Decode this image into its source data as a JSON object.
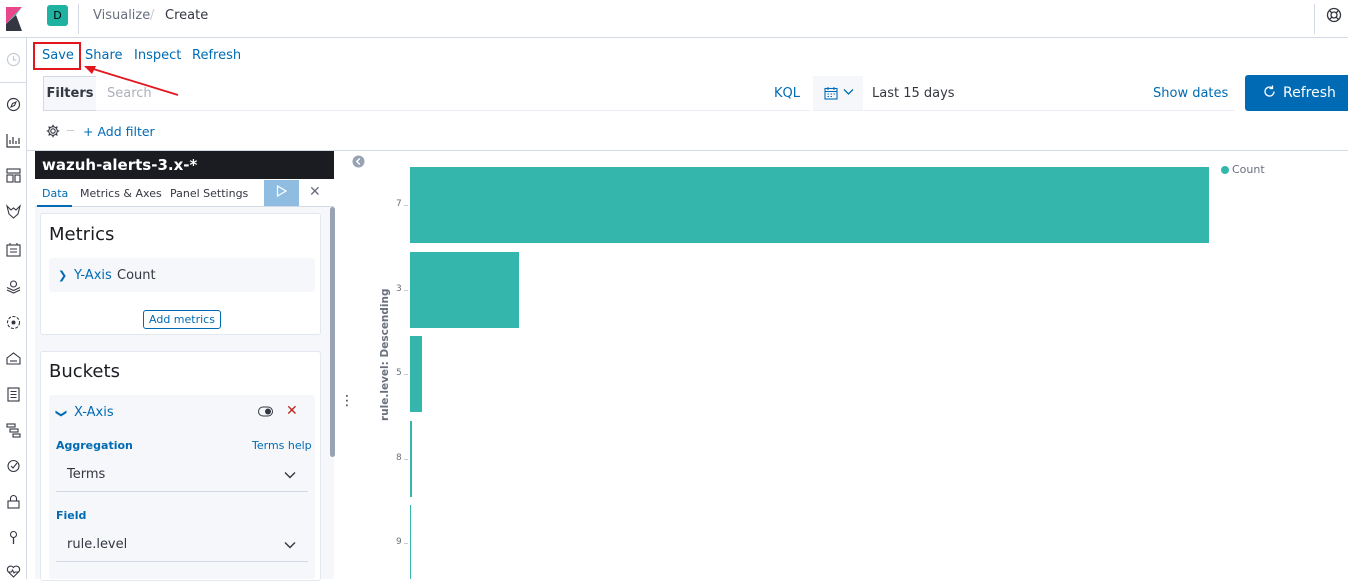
{
  "app": {
    "space_initial": "D",
    "breadcrumbs": [
      "Visualize",
      "Create"
    ]
  },
  "menu": {
    "save": "Save",
    "share": "Share",
    "inspect": "Inspect",
    "refresh": "Refresh"
  },
  "query_bar": {
    "filters_label": "Filters",
    "search_placeholder": "Search",
    "kql": "KQL",
    "date_range": "Last 15 days",
    "show_dates": "Show dates",
    "refresh_button": "Refresh",
    "add_filter": "+ Add filter"
  },
  "editor": {
    "index_pattern": "wazuh-alerts-3.x-*",
    "tabs": [
      "Data",
      "Metrics & Axes",
      "Panel Settings"
    ],
    "active_tab": "Data",
    "metrics": {
      "title": "Metrics",
      "y_axis_label": "Y-Axis",
      "y_axis_value": "Count",
      "add_button": "Add metrics"
    },
    "buckets": {
      "title": "Buckets",
      "x_axis_label": "X-Axis",
      "aggregation_label": "Aggregation",
      "aggregation_help": "Terms help",
      "aggregation_value": "Terms",
      "field_label": "Field",
      "field_value": "rule.level"
    }
  },
  "accent_color": "#006bb4",
  "bar_color": "#34b6ad",
  "chart_data": {
    "type": "bar",
    "orientation": "horizontal",
    "ylabel": "rule.level: Descending",
    "categories": [
      "7",
      "3",
      "5",
      "8",
      "9"
    ],
    "series": [
      {
        "name": "Count",
        "values": [
          800,
          109,
          12,
          2,
          1
        ]
      }
    ],
    "legend": "top-right",
    "grid": false
  }
}
